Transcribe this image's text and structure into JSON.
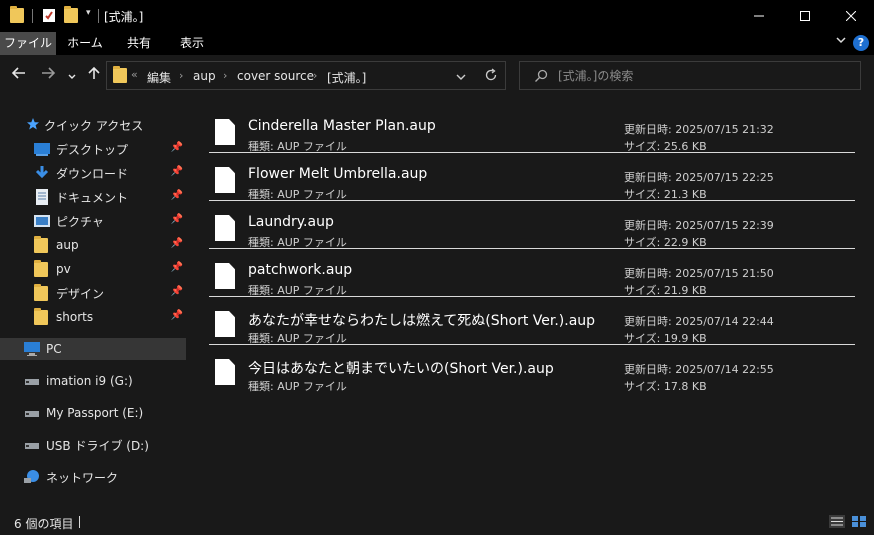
{
  "window": {
    "title": "[式浦。]",
    "minimize": "—",
    "maximize": "☐",
    "close": "✕"
  },
  "ribbon": {
    "tabs": [
      {
        "label": "ファイル",
        "active": true
      },
      {
        "label": "ホーム",
        "active": false
      },
      {
        "label": "共有",
        "active": false
      },
      {
        "label": "表示",
        "active": false
      }
    ],
    "help": "?"
  },
  "nav": {
    "breadcrumbs": [
      "編集",
      "aup",
      "cover source",
      "[式浦。]"
    ],
    "overflow": "«",
    "search_placeholder": "[式浦。]の検索"
  },
  "sidebar": {
    "quick_access": "クイック アクセス",
    "pinned": [
      {
        "label": "デスクトップ",
        "icon": "desktop-icon"
      },
      {
        "label": "ダウンロード",
        "icon": "download-icon"
      },
      {
        "label": "ドキュメント",
        "icon": "document-icon"
      },
      {
        "label": "ピクチャ",
        "icon": "picture-icon"
      },
      {
        "label": "aup",
        "icon": "folder-icon"
      },
      {
        "label": "pv",
        "icon": "folder-icon"
      },
      {
        "label": "デザイン",
        "icon": "folder-icon"
      },
      {
        "label": "shorts",
        "icon": "folder-icon"
      }
    ],
    "pc": "PC",
    "drives": [
      {
        "label": "imation i9 (G:)"
      },
      {
        "label": "My Passport (E:)"
      },
      {
        "label": "USB ドライブ (D:)"
      }
    ],
    "network": "ネットワーク"
  },
  "files": [
    {
      "name": "Cinderella Master Plan.aup",
      "type": "種類: AUP ファイル",
      "date": "更新日時: 2025/07/15 21:32",
      "size": "サイズ: 25.6 KB"
    },
    {
      "name": "Flower Melt Umbrella.aup",
      "type": "種類: AUP ファイル",
      "date": "更新日時: 2025/07/15 22:25",
      "size": "サイズ: 21.3 KB"
    },
    {
      "name": "Laundry.aup",
      "type": "種類: AUP ファイル",
      "date": "更新日時: 2025/07/15 22:39",
      "size": "サイズ: 22.9 KB"
    },
    {
      "name": "patchwork.aup",
      "type": "種類: AUP ファイル",
      "date": "更新日時: 2025/07/15 21:50",
      "size": "サイズ: 21.9 KB"
    },
    {
      "name": "あなたが幸せならわたしは燃えて死ぬ(Short Ver.).aup",
      "type": "種類: AUP ファイル",
      "date": "更新日時: 2025/07/14 22:44",
      "size": "サイズ: 19.9 KB"
    },
    {
      "name": "今日はあなたと朝までいたいの(Short Ver.).aup",
      "type": "種類: AUP ファイル",
      "date": "更新日時: 2025/07/14 22:55",
      "size": "サイズ: 17.8 KB"
    }
  ],
  "status": {
    "item_count": "6 個の項目"
  },
  "colors": {
    "background": "#191919",
    "titlebar": "#000000",
    "folder": "#f0c75a",
    "accent_blue": "#1e6fd0"
  }
}
